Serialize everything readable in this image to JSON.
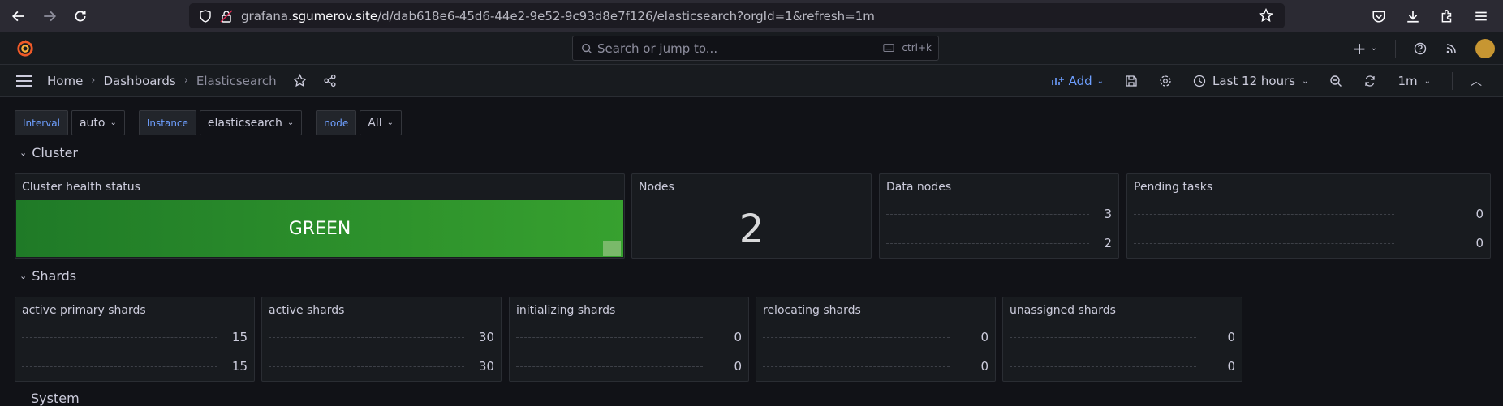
{
  "browser": {
    "url_host_prefix": "grafana.",
    "url_host": "sgumerov.site",
    "url_path": "/d/dab618e6-45d6-44e2-9e52-9c93d8e7f126/elasticsearch?orgId=1&refresh=1m"
  },
  "topbar": {
    "search_placeholder": "Search or jump to...",
    "shortcut": "ctrl+k",
    "plus_label": "+"
  },
  "breadcrumbs": [
    {
      "label": "Home"
    },
    {
      "label": "Dashboards"
    },
    {
      "label": "Elasticsearch"
    }
  ],
  "toolbar": {
    "add_label": "Add",
    "time_range": "Last 12 hours",
    "refresh_interval": "1m"
  },
  "variables": [
    {
      "label": "Interval",
      "value": "auto"
    },
    {
      "label": "Instance",
      "value": "elasticsearch"
    },
    {
      "label": "node",
      "value": "All"
    }
  ],
  "rows": {
    "cluster": "Cluster",
    "shards": "Shards",
    "system": "System"
  },
  "cluster_panels": {
    "health": {
      "title": "Cluster health status",
      "value": "GREEN"
    },
    "nodes": {
      "title": "Nodes",
      "value": "2"
    },
    "data_nodes": {
      "title": "Data nodes",
      "values": [
        "3",
        "2"
      ]
    },
    "pending_tasks": {
      "title": "Pending tasks",
      "values": [
        "0",
        "0"
      ]
    }
  },
  "shard_panels": [
    {
      "title": "active primary shards",
      "values": [
        "15",
        "15"
      ]
    },
    {
      "title": "active shards",
      "values": [
        "30",
        "30"
      ]
    },
    {
      "title": "initializing shards",
      "values": [
        "0",
        "0"
      ]
    },
    {
      "title": "relocating shards",
      "values": [
        "0",
        "0"
      ]
    },
    {
      "title": "unassigned shards",
      "values": [
        "0",
        "0"
      ]
    }
  ],
  "colors": {
    "accent": "#6e9fff",
    "health_green": "#37a12f",
    "background": "#111217",
    "panel": "#181b1f"
  }
}
